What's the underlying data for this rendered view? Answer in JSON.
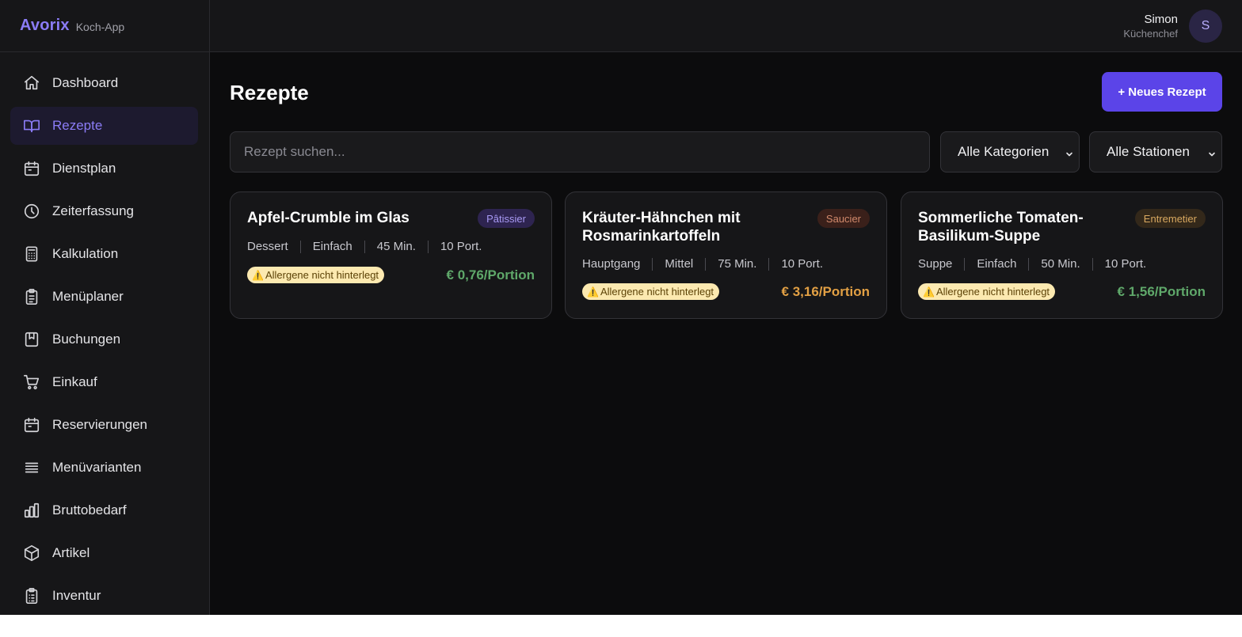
{
  "brand": {
    "name": "Avorix",
    "subtitle": "Koch-App",
    "color": "#8b7cf6"
  },
  "user": {
    "name": "Simon",
    "role": "Küchenchef",
    "initial": "S"
  },
  "sidebar": {
    "items": [
      {
        "label": "Dashboard",
        "icon": "home-icon",
        "active": false
      },
      {
        "label": "Rezepte",
        "icon": "book-icon",
        "active": true
      },
      {
        "label": "Dienstplan",
        "icon": "calendar-icon",
        "active": false
      },
      {
        "label": "Zeiterfassung",
        "icon": "clock-icon",
        "active": false
      },
      {
        "label": "Kalkulation",
        "icon": "calculator-icon",
        "active": false
      },
      {
        "label": "Menüplaner",
        "icon": "clipboard-icon",
        "active": false
      },
      {
        "label": "Buchungen",
        "icon": "bookmark-book-icon",
        "active": false
      },
      {
        "label": "Einkauf",
        "icon": "cart-icon",
        "active": false
      },
      {
        "label": "Reservierungen",
        "icon": "calendar-icon",
        "active": false
      },
      {
        "label": "Menüvarianten",
        "icon": "list-icon",
        "active": false
      },
      {
        "label": "Bruttobedarf",
        "icon": "bar-chart-icon",
        "active": false
      },
      {
        "label": "Artikel",
        "icon": "box-icon",
        "active": false
      },
      {
        "label": "Inventur",
        "icon": "clipboard-list-icon",
        "active": false
      }
    ]
  },
  "main": {
    "title": "Rezepte",
    "new_button": "+ Neues Rezept",
    "search_placeholder": "Rezept suchen...",
    "filter_category": "Alle Kategorien",
    "filter_station": "Alle Stationen"
  },
  "recipes": [
    {
      "title": "Apfel-Crumble im Glas",
      "station": "Pâtissier",
      "station_bg": "#2e2450",
      "station_fg": "#a99af5",
      "category": "Dessert",
      "difficulty": "Einfach",
      "duration": "45 Min.",
      "portions": "10 Port.",
      "allergen_note": "Allergene nicht hinterlegt",
      "price": "€ 0,76/Portion",
      "price_color": "#5fa86a"
    },
    {
      "title": "Kräuter-Hähnchen mit Rosmarinkartoffeln",
      "station": "Saucier",
      "station_bg": "#3a201a",
      "station_fg": "#d28a6c",
      "category": "Hauptgang",
      "difficulty": "Mittel",
      "duration": "75 Min.",
      "portions": "10 Port.",
      "allergen_note": "Allergene nicht hinterlegt",
      "price": "€ 3,16/Portion",
      "price_color": "#e2a044"
    },
    {
      "title": "Sommerliche Tomaten-Basilikum-Suppe",
      "station": "Entremetier",
      "station_bg": "#33281a",
      "station_fg": "#d8a860",
      "category": "Suppe",
      "difficulty": "Einfach",
      "duration": "50 Min.",
      "portions": "10 Port.",
      "allergen_note": "Allergene nicht hinterlegt",
      "price": "€ 1,56/Portion",
      "price_color": "#5fa86a"
    }
  ]
}
